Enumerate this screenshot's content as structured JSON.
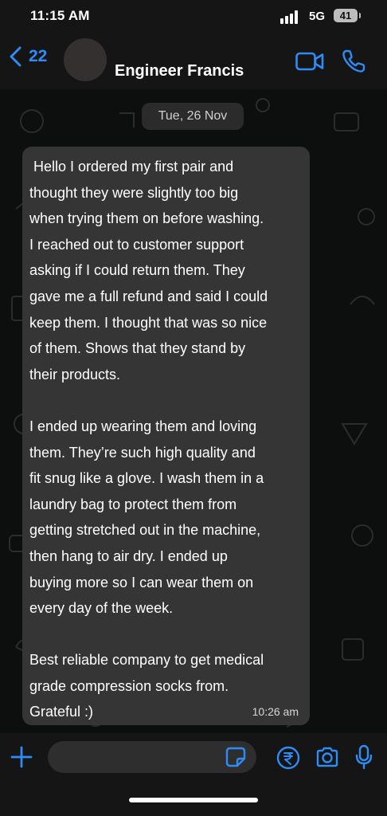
{
  "status_bar": {
    "time": "11:15 AM",
    "network": "5G",
    "battery": "41"
  },
  "header": {
    "back_count": "22",
    "contact_name": "Engineer Francis"
  },
  "chat": {
    "date_label": "Tue, 26 Nov",
    "messages": [
      {
        "text": " Hello I ordered my first pair and\nthought they were slightly too big\nwhen trying them on before washing.\nI reached out to customer support\nasking if I could return them. They\ngave me a full refund and said I could\nkeep them. I thought that was so nice\nof them. Shows that they stand by\ntheir products.\n\nI ended up wearing them and loving\nthem. They’re such high quality and\nfit snug like a glove. I wash them in a\nlaundry bag to protect them from\ngetting stretched out in the machine,\nthen hang to air dry. I ended up\nbuying more so I can wear them on\nevery day of the week.\n\nBest reliable company to get medical\ngrade compression socks from.\nGrateful :)",
        "time": "10:26 am"
      }
    ]
  },
  "input_bar": {
    "message_value": ""
  },
  "icons": [
    "back-chevron-icon",
    "video-call-icon",
    "phone-icon",
    "plus-icon",
    "sticker-icon",
    "rupee-payment-icon",
    "camera-icon",
    "microphone-icon"
  ],
  "colors": {
    "accent": "#2f8cf6",
    "bubble": "#353535",
    "bar": "#151515"
  }
}
